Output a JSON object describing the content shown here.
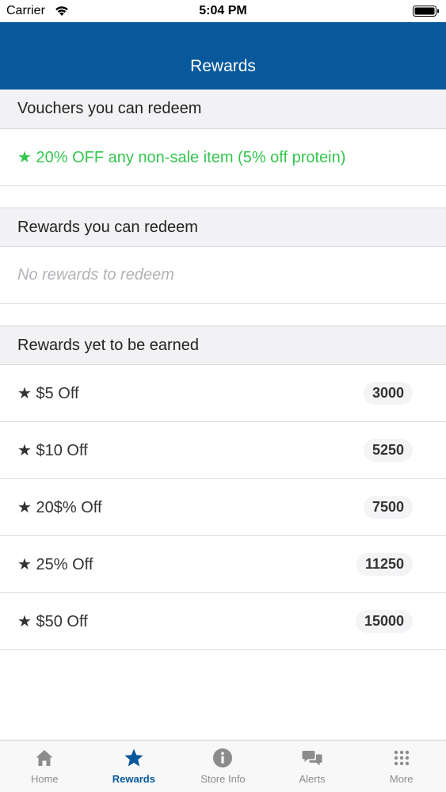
{
  "status_bar": {
    "carrier": "Carrier",
    "time": "5:04 PM"
  },
  "nav": {
    "title": "Rewards"
  },
  "vouchers": {
    "header": "Vouchers you can redeem",
    "items": [
      {
        "label": "★ 20% OFF any non-sale item (5% off protein)"
      }
    ]
  },
  "redeemable": {
    "header": "Rewards you can redeem",
    "empty_text": "No rewards to redeem"
  },
  "unearned": {
    "header": "Rewards yet to be earned",
    "items": [
      {
        "label": "★ $5 Off",
        "points": "3000"
      },
      {
        "label": "★ $10 Off",
        "points": "5250"
      },
      {
        "label": "★ 20$% Off",
        "points": "7500"
      },
      {
        "label": "★ 25% Off",
        "points": "11250"
      },
      {
        "label": "★ $50 Off",
        "points": "15000"
      }
    ]
  },
  "tabs": [
    {
      "label": "Home",
      "icon": "home-icon",
      "active": false
    },
    {
      "label": "Rewards",
      "icon": "star-icon",
      "active": true
    },
    {
      "label": "Store Info",
      "icon": "info-icon",
      "active": false
    },
    {
      "label": "Alerts",
      "icon": "chat-bubbles-icon",
      "active": false
    },
    {
      "label": "More",
      "icon": "grid-dots-icon",
      "active": false
    }
  ],
  "colors": {
    "nav_background": "#07599b",
    "voucher_text": "#35c64f",
    "active_tab": "#07599b",
    "inactive_tab": "#8c8c8c"
  }
}
